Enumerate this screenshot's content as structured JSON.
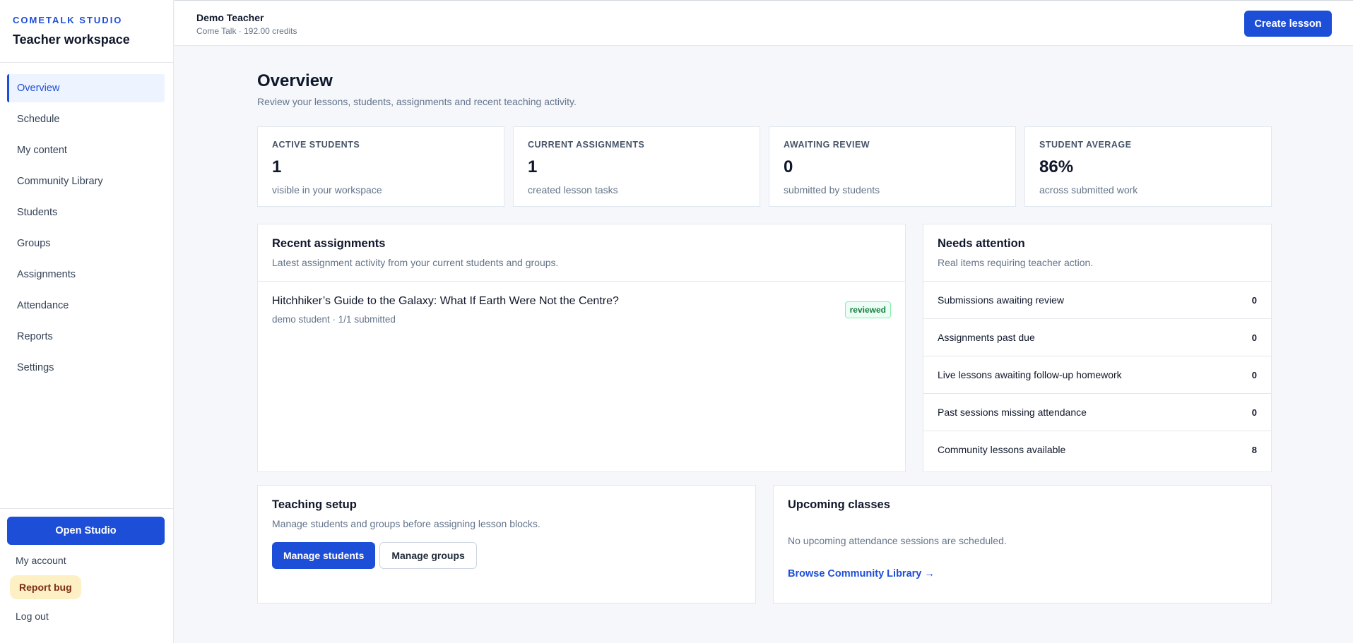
{
  "brand": {
    "kicker": "COMETALK STUDIO",
    "title": "Teacher workspace"
  },
  "nav": [
    {
      "label": "Overview",
      "active": true
    },
    {
      "label": "Schedule"
    },
    {
      "label": "My content"
    },
    {
      "label": "Community Library"
    },
    {
      "label": "Students"
    },
    {
      "label": "Groups"
    },
    {
      "label": "Assignments"
    },
    {
      "label": "Attendance"
    },
    {
      "label": "Reports"
    },
    {
      "label": "Settings"
    }
  ],
  "sidebar_bottom": {
    "open_studio": "Open Studio",
    "my_account": "My account",
    "report_bug": "Report bug",
    "log_out": "Log out"
  },
  "topbar": {
    "user_name": "Demo Teacher",
    "user_meta": "Come Talk · 192.00 credits",
    "create_lesson": "Create lesson"
  },
  "page": {
    "title": "Overview",
    "subtitle": "Review your lessons, students, assignments and recent teaching activity."
  },
  "stats": [
    {
      "label": "ACTIVE STUDENTS",
      "value": "1",
      "note": "visible in your workspace"
    },
    {
      "label": "CURRENT ASSIGNMENTS",
      "value": "1",
      "note": "created lesson tasks"
    },
    {
      "label": "AWAITING REVIEW",
      "value": "0",
      "note": "submitted by students"
    },
    {
      "label": "STUDENT AVERAGE",
      "value": "86%",
      "note": "across submitted work"
    }
  ],
  "recent_assignments": {
    "title": "Recent assignments",
    "desc": "Latest assignment activity from your current students and groups.",
    "items": [
      {
        "title": "Hitchhiker’s Guide to the Galaxy: What If Earth Were Not the Centre?",
        "meta": "demo student · 1/1 submitted",
        "badge": "reviewed"
      }
    ]
  },
  "needs_attention": {
    "title": "Needs attention",
    "desc": "Real items requiring teacher action.",
    "items": [
      {
        "label": "Submissions awaiting review",
        "count": "0"
      },
      {
        "label": "Assignments past due",
        "count": "0"
      },
      {
        "label": "Live lessons awaiting follow-up homework",
        "count": "0"
      },
      {
        "label": "Past sessions missing attendance",
        "count": "0"
      },
      {
        "label": "Community lessons available",
        "count": "8"
      }
    ]
  },
  "teaching_setup": {
    "title": "Teaching setup",
    "desc": "Manage students and groups before assigning lesson blocks.",
    "manage_students": "Manage students",
    "manage_groups": "Manage groups"
  },
  "upcoming": {
    "title": "Upcoming classes",
    "empty": "No upcoming attendance sessions are scheduled.",
    "browse": "Browse Community Library →"
  },
  "colors": {
    "accent": "#1d4ed8",
    "success": "#15803d",
    "bug_bg": "#fdf0c4"
  }
}
